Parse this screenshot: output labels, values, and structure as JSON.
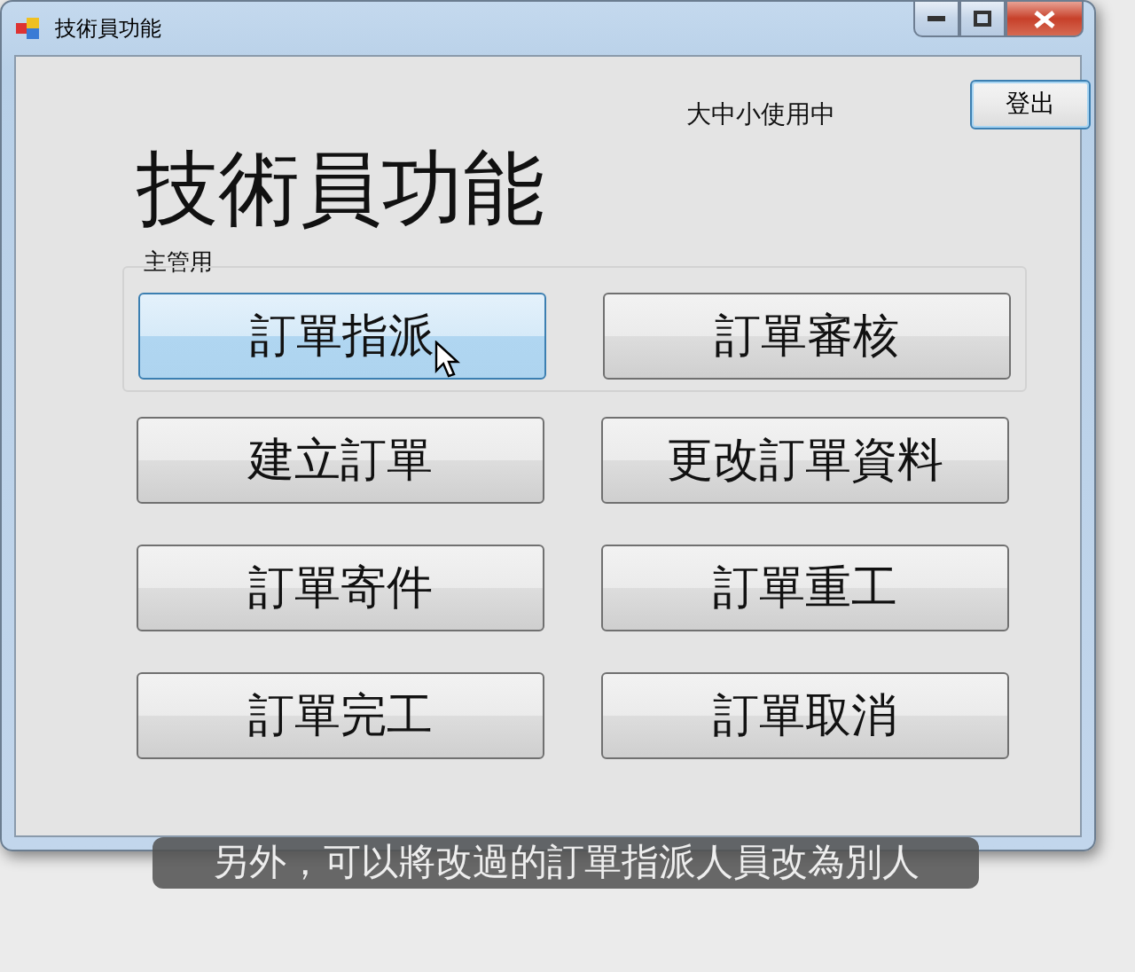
{
  "window": {
    "title": "技術員功能"
  },
  "status_label": "大中小使用中",
  "logout_button": "登出",
  "heading": "技術員功能",
  "group": {
    "label": "主管用",
    "buttons": [
      {
        "label": "訂單指派",
        "hovered": true
      },
      {
        "label": "訂單審核",
        "hovered": false
      }
    ]
  },
  "buttons": [
    {
      "label": "建立訂單",
      "hovered": false
    },
    {
      "label": "更改訂單資料",
      "hovered": false
    },
    {
      "label": "訂單寄件",
      "hovered": false
    },
    {
      "label": "訂單重工",
      "hovered": false
    },
    {
      "label": "訂單完工",
      "hovered": false
    },
    {
      "label": "訂單取消",
      "hovered": false
    }
  ],
  "caption": "另外，可以將改過的訂單指派人員改為別人"
}
